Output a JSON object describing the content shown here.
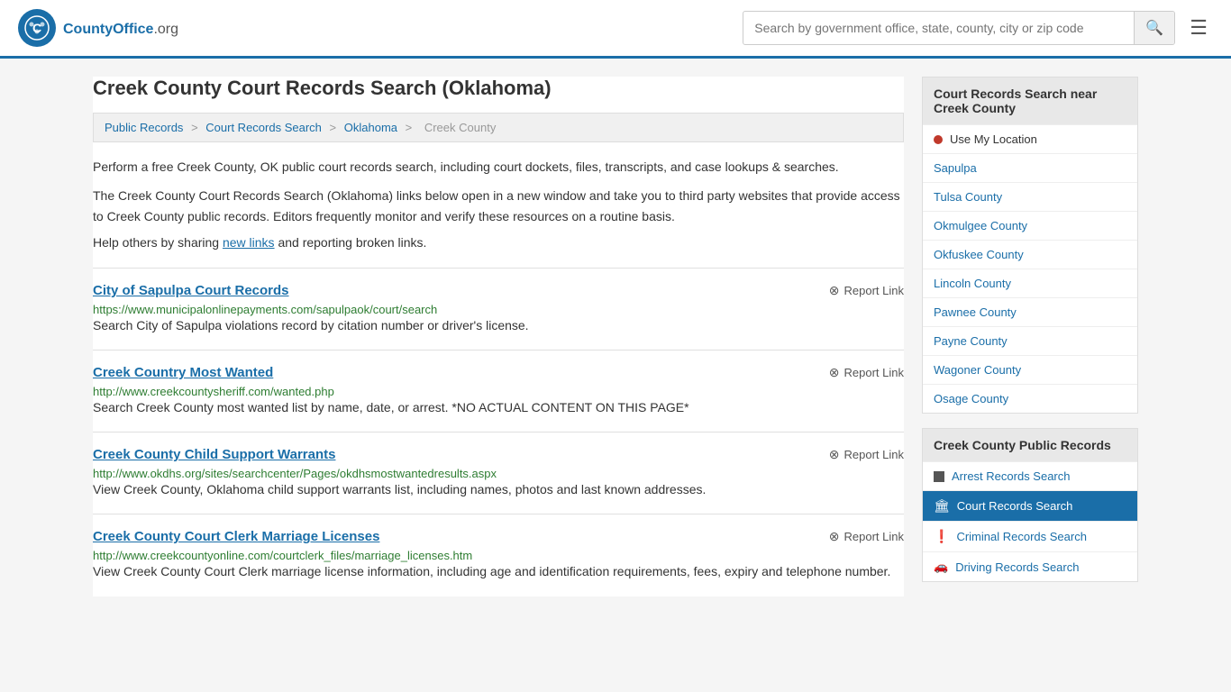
{
  "header": {
    "logo_text": "CountyOffice",
    "logo_suffix": ".org",
    "search_placeholder": "Search by government office, state, county, city or zip code"
  },
  "page": {
    "title": "Creek County Court Records Search (Oklahoma)",
    "breadcrumb": {
      "items": [
        "Public Records",
        "Court Records Search",
        "Oklahoma",
        "Creek County"
      ]
    },
    "description1": "Perform a free Creek County, OK public court records search, including court dockets, files, transcripts, and case lookups & searches.",
    "description2": "The Creek County Court Records Search (Oklahoma) links below open in a new window and take you to third party websites that provide access to Creek County public records. Editors frequently monitor and verify these resources on a routine basis.",
    "share_text": "Help others by sharing ",
    "share_link": "new links",
    "share_suffix": " and reporting broken links."
  },
  "records": [
    {
      "title": "City of Sapulpa Court Records",
      "url": "https://www.municipalonlinepayments.com/sapulpaok/court/search",
      "description": "Search City of Sapulpa violations record by citation number or driver's license.",
      "report_label": "Report Link"
    },
    {
      "title": "Creek Country Most Wanted",
      "url": "http://www.creekcountysheriff.com/wanted.php",
      "description": "Search Creek County most wanted list by name, date, or arrest. *NO ACTUAL CONTENT ON THIS PAGE*",
      "report_label": "Report Link"
    },
    {
      "title": "Creek County Child Support Warrants",
      "url": "http://www.okdhs.org/sites/searchcenter/Pages/okdhsmostwantedresults.aspx",
      "description": "View Creek County, Oklahoma child support warrants list, including names, photos and last known addresses.",
      "report_label": "Report Link"
    },
    {
      "title": "Creek County Court Clerk Marriage Licenses",
      "url": "http://www.creekcountyonline.com/courtclerk_files/marriage_licenses.htm",
      "description": "View Creek County Court Clerk marriage license information, including age and identification requirements, fees, expiry and telephone number.",
      "report_label": "Report Link"
    }
  ],
  "sidebar": {
    "nearby_section_title": "Court Records Search near Creek County",
    "use_location_label": "Use My Location",
    "nearby_links": [
      "Sapulpa",
      "Tulsa County",
      "Okmulgee County",
      "Okfuskee County",
      "Lincoln County",
      "Pawnee County",
      "Payne County",
      "Wagoner County",
      "Osage County"
    ],
    "public_records_title": "Creek County Public Records",
    "public_records_items": [
      {
        "label": "Arrest Records Search",
        "icon": "square",
        "active": false
      },
      {
        "label": "Court Records Search",
        "icon": "bank",
        "active": true
      },
      {
        "label": "Criminal Records Search",
        "icon": "exclaim",
        "active": false
      },
      {
        "label": "Driving Records Search",
        "icon": "car",
        "active": false
      }
    ]
  }
}
